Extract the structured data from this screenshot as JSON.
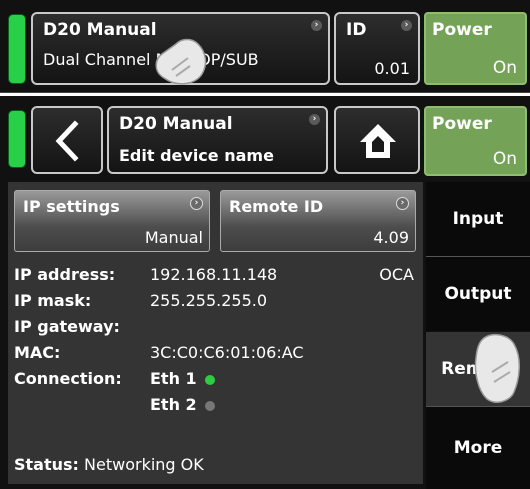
{
  "top": {
    "device": {
      "title": "D20 Manual",
      "subtitle": "Dual Channel Mix TOP/SUB"
    },
    "id_box": {
      "label": "ID",
      "value": "0.01"
    },
    "power": {
      "label": "Power",
      "state": "On"
    }
  },
  "bottom": {
    "device": {
      "title": "D20 Manual",
      "subtitle": "Edit device name"
    },
    "power": {
      "label": "Power",
      "state": "On"
    },
    "ip_settings": {
      "label": "IP settings",
      "value": "Manual"
    },
    "remote_id": {
      "label": "Remote ID",
      "value": "4.09"
    },
    "info": {
      "ip_address_label": "IP address:",
      "ip_address": "192.168.11.148",
      "ip_protocol": "OCA",
      "ip_mask_label": "IP mask:",
      "ip_mask": "255.255.255.0",
      "ip_gateway_label": "IP gateway:",
      "mac_label": "MAC:",
      "mac": "3C:C0:C6:01:06:AC",
      "connection_label": "Connection:",
      "eth1": "Eth 1",
      "eth2": "Eth 2",
      "status_label": "Status:",
      "status_value": "Networking OK"
    },
    "tabs": [
      "Input",
      "Output",
      "Remote",
      "More"
    ]
  },
  "icons": {
    "back": "chevron-left-icon",
    "home": "home-icon",
    "chevron": "chevron-right-icon",
    "hand": "hand-pointer-icon"
  },
  "colors": {
    "led": "#28d04a",
    "power": "#74a357",
    "eth1_status": "#2ecc40",
    "eth2_status": "#777777"
  }
}
